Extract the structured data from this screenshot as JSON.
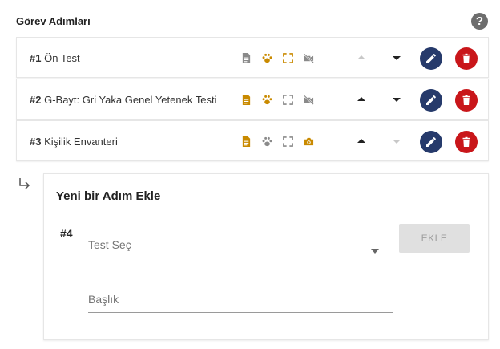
{
  "header": {
    "title": "Görev Adımları",
    "help_icon": "question-circle-icon"
  },
  "steps": [
    {
      "num": "#1",
      "name": "Ön Test",
      "icons": [
        {
          "name": "document-icon",
          "active": false
        },
        {
          "name": "paw-icon",
          "active": true
        },
        {
          "name": "fullscreen-icon",
          "active": true
        },
        {
          "name": "video-off-icon",
          "active": false
        }
      ],
      "up_enabled": false,
      "down_enabled": true
    },
    {
      "num": "#2",
      "name": "G-Bayt: Gri Yaka Genel Yetenek Testi",
      "icons": [
        {
          "name": "document-icon",
          "active": true
        },
        {
          "name": "paw-icon",
          "active": true
        },
        {
          "name": "fullscreen-icon",
          "active": false
        },
        {
          "name": "video-off-icon",
          "active": false
        }
      ],
      "up_enabled": true,
      "down_enabled": true
    },
    {
      "num": "#3",
      "name": "Kişilik Envanteri",
      "icons": [
        {
          "name": "document-icon",
          "active": true
        },
        {
          "name": "paw-icon",
          "active": false
        },
        {
          "name": "fullscreen-icon",
          "active": false
        },
        {
          "name": "camera-icon",
          "active": true
        }
      ],
      "up_enabled": true,
      "down_enabled": false
    }
  ],
  "add_step": {
    "title": "Yeni bir Adım Ekle",
    "num": "#4",
    "test_select_placeholder": "Test Seç",
    "add_button_label": "EKLE",
    "title_field_placeholder": "Başlık"
  },
  "colors": {
    "active_icon": "#c98a00",
    "inactive_icon": "#8a8a8a",
    "edit_button": "#263a6b",
    "delete_button": "#c9161a"
  }
}
